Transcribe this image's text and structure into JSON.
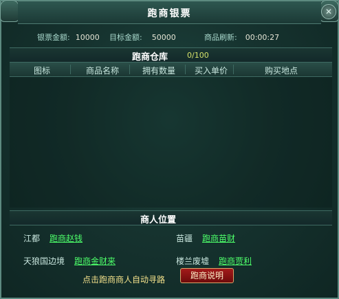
{
  "window": {
    "title": "跑商银票",
    "close_label": "✕"
  },
  "info": {
    "ticket_label": "银票金额:",
    "ticket_value": "10000",
    "target_label": "目标金额:",
    "target_value": "50000",
    "refresh_label": "商品刷新:",
    "refresh_value": "00:00:27"
  },
  "warehouse": {
    "title": "跑商仓库",
    "count": "0/100",
    "columns": [
      "图标",
      "商品名称",
      "拥有数量",
      "买入单价",
      "购买地点"
    ],
    "rows": []
  },
  "merchants": {
    "title": "商人位置",
    "items": [
      {
        "city": "江都",
        "npc": "跑商赵钱"
      },
      {
        "city": "苗疆",
        "npc": "跑商苗财"
      },
      {
        "city": "天狼国边境",
        "npc": "跑商金财来"
      },
      {
        "city": "楼兰废墟",
        "npc": "跑商贾利"
      }
    ],
    "hint": "点击跑商商人自动寻路",
    "help_button": "跑商说明"
  },
  "colors": {
    "panel_bg": "#16332f",
    "link_green": "#4dff6a",
    "hint_yellow": "#f2e08a",
    "button_red": "#a21a1a"
  }
}
